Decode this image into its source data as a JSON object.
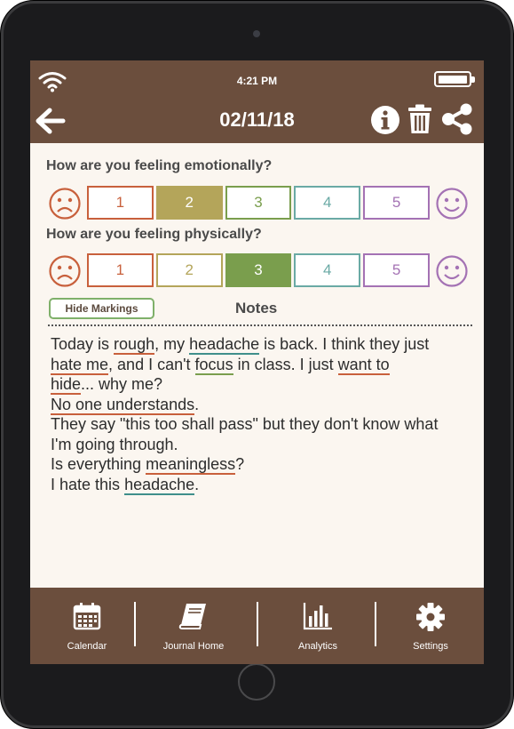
{
  "status_bar": {
    "time": "4:21 PM"
  },
  "header": {
    "date": "02/11/18"
  },
  "questions": {
    "emotional": {
      "label": "How are you feeling emotionally?",
      "selected": 2
    },
    "physical": {
      "label": "How are you feeling physically?",
      "selected": 3
    }
  },
  "scale": {
    "options": [
      "1",
      "2",
      "3",
      "4",
      "5"
    ],
    "colors": [
      "#c8603c",
      "#b4a55a",
      "#7a9e4d",
      "#6aaaa5",
      "#a472b4"
    ],
    "face_color_sad": "#c8603c",
    "face_color_happy": "#a472b4"
  },
  "notes": {
    "hide_markings_label": "Hide Markings",
    "title": "Notes",
    "text": {
      "t1": "Today is ",
      "w_rough": "rough",
      "t2": ", my ",
      "w_headache1": "headache",
      "t3": " is back. I think they just",
      "w_hate_me": "hate me",
      "t4": ", and I can't ",
      "w_focus": "focus",
      "t5": " in class. I just ",
      "w_want_to": "want to",
      "w_hide": "hide",
      "t6": "... why me?",
      "w_no_one": "No one understands",
      "t7": ".",
      "line4": "They say \"this too shall pass\" but they don't know what",
      "line5": "I'm going through.",
      "t8": "Is everything ",
      "w_meaningless": "meaningless",
      "t9": "?",
      "t10": "I hate this ",
      "w_headache2": "headache",
      "t11": "."
    }
  },
  "tabs": [
    {
      "label": "Calendar",
      "icon": "calendar-icon"
    },
    {
      "label": "Journal Home",
      "icon": "journal-icon"
    },
    {
      "label": "Analytics",
      "icon": "analytics-icon"
    },
    {
      "label": "Settings",
      "icon": "gear-icon"
    }
  ],
  "colors": {
    "brown": "#6b4e3d",
    "background": "#fbf6f0"
  }
}
